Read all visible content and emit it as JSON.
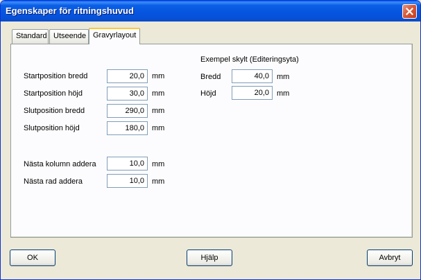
{
  "window": {
    "title": "Egenskaper för ritningshuvud"
  },
  "tabs": [
    {
      "label": "Standard",
      "active": false
    },
    {
      "label": "Utseende",
      "active": false
    },
    {
      "label": "Gravyrlayout",
      "active": true
    }
  ],
  "layout_fields": [
    {
      "label": "Startposition bredd",
      "value": "20,0",
      "unit": "mm"
    },
    {
      "label": "Startposition höjd",
      "value": "30,0",
      "unit": "mm"
    },
    {
      "label": "Slutposition bredd",
      "value": "290,0",
      "unit": "mm"
    },
    {
      "label": "Slutposition höjd",
      "value": "180,0",
      "unit": "mm"
    }
  ],
  "add_fields": [
    {
      "label": "Nästa kolumn addera",
      "value": "10,0",
      "unit": "mm"
    },
    {
      "label": "Nästa rad addera",
      "value": "10,0",
      "unit": "mm"
    }
  ],
  "example": {
    "heading": "Exempel skylt (Editeringsyta)",
    "fields": [
      {
        "label": "Bredd",
        "value": "40,0",
        "unit": "mm"
      },
      {
        "label": "Höjd",
        "value": "20,0",
        "unit": "mm"
      }
    ]
  },
  "buttons": {
    "ok": "OK",
    "help": "Hjälp",
    "cancel": "Avbryt"
  }
}
